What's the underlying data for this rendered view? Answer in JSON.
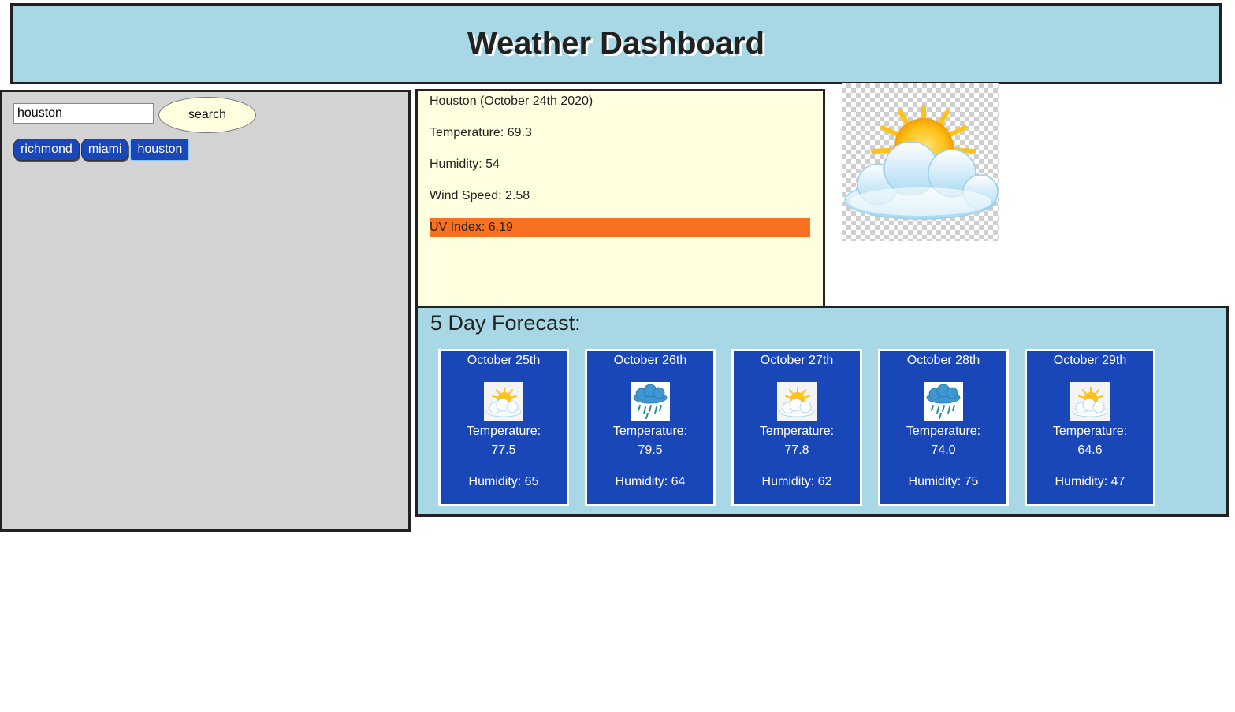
{
  "header": {
    "title": "Weather Dashboard"
  },
  "search": {
    "value": "houston",
    "button_label": "search"
  },
  "history": [
    {
      "label": "richmond"
    },
    {
      "label": "miami"
    },
    {
      "label": "houston"
    }
  ],
  "current": {
    "heading": "Houston (October 24th 2020)",
    "temperature": "Temperature: 69.3",
    "humidity": "Humidity: 54",
    "wind": "Wind Speed: 2.58",
    "uv": "UV Index: 6.19",
    "uv_color": "#f97020",
    "icon": "partly-cloudy-icon"
  },
  "forecast": {
    "title": "5 Day Forecast:",
    "days": [
      {
        "date": "October 25th",
        "icon": "partly-cloudy-icon",
        "temp_label": "Temperature:",
        "temp": "77.5",
        "humidity": "Humidity: 65"
      },
      {
        "date": "October 26th",
        "icon": "rain-cloud-icon",
        "temp_label": "Temperature:",
        "temp": "79.5",
        "humidity": "Humidity: 64"
      },
      {
        "date": "October 27th",
        "icon": "partly-cloudy-icon",
        "temp_label": "Temperature:",
        "temp": "77.8",
        "humidity": "Humidity: 62"
      },
      {
        "date": "October 28th",
        "icon": "rain-cloud-icon",
        "temp_label": "Temperature:",
        "temp": "74.0",
        "humidity": "Humidity: 75"
      },
      {
        "date": "October 29th",
        "icon": "partly-cloudy-icon",
        "temp_label": "Temperature:",
        "temp": "64.6",
        "humidity": "Humidity: 47"
      }
    ]
  }
}
